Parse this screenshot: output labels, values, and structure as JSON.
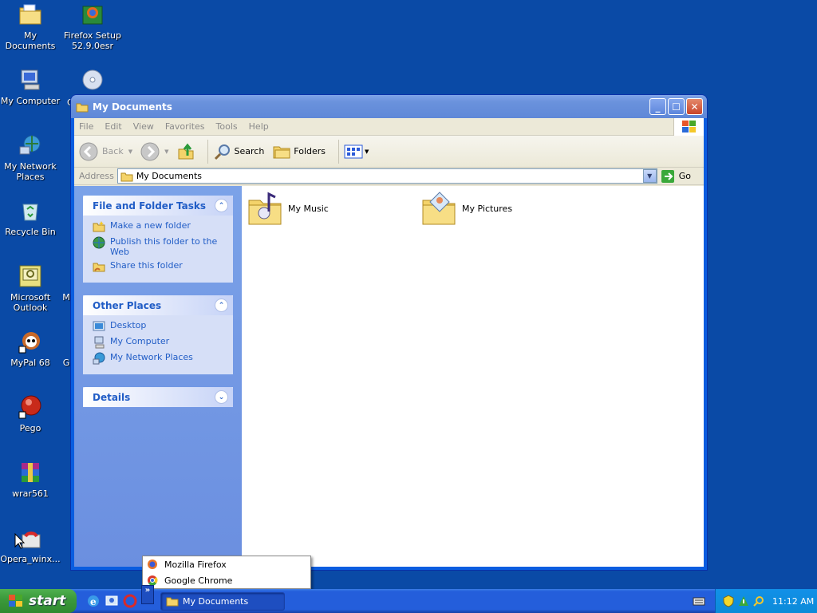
{
  "desktop": {
    "icons": [
      {
        "id": "my-documents",
        "label": "My Documents"
      },
      {
        "id": "firefox-setup",
        "label": "Firefox Setup 52.9.0esr"
      },
      {
        "id": "my-computer",
        "label": "My Computer"
      },
      {
        "id": "my-network-places",
        "label": "My Network Places"
      },
      {
        "id": "recycle-bin",
        "label": "Recycle Bin"
      },
      {
        "id": "microsoft-outlook",
        "label": "Microsoft Outlook"
      },
      {
        "id": "mypal-68",
        "label": "MyPal 68"
      },
      {
        "id": "pego",
        "label": "Pego"
      },
      {
        "id": "wrar561",
        "label": "wrar561"
      },
      {
        "id": "opera-winx",
        "label": "Opera_winx..."
      }
    ],
    "partial_labels": {
      "c1": "C",
      "m1": "M",
      "g1": "G"
    }
  },
  "window": {
    "title": "My Documents",
    "menu": [
      "File",
      "Edit",
      "View",
      "Favorites",
      "Tools",
      "Help"
    ],
    "toolbar": {
      "back": "Back",
      "search": "Search",
      "folders": "Folders"
    },
    "address": {
      "label": "Address",
      "value": "My Documents",
      "go": "Go"
    },
    "left_pane": {
      "file_tasks": {
        "title": "File and Folder Tasks",
        "items": [
          "Make a new folder",
          "Publish this folder to the Web",
          "Share this folder"
        ]
      },
      "other_places": {
        "title": "Other Places",
        "items": [
          "Desktop",
          "My Computer",
          "My Network Places"
        ]
      },
      "details": {
        "title": "Details"
      }
    },
    "folders": [
      {
        "name": "My Music"
      },
      {
        "name": "My Pictures"
      }
    ]
  },
  "popup_menu": {
    "items": [
      "Mozilla Firefox",
      "Google Chrome"
    ]
  },
  "taskbar": {
    "start": "start",
    "quicklaunch_overflow": "»",
    "active_task": "My Documents",
    "clock": "11:12 AM"
  },
  "colors": {
    "desktop": "#0a4aa6",
    "link": "#215dc6",
    "titlebar": "#6a92dc",
    "start_green": "#3c9a3c"
  }
}
